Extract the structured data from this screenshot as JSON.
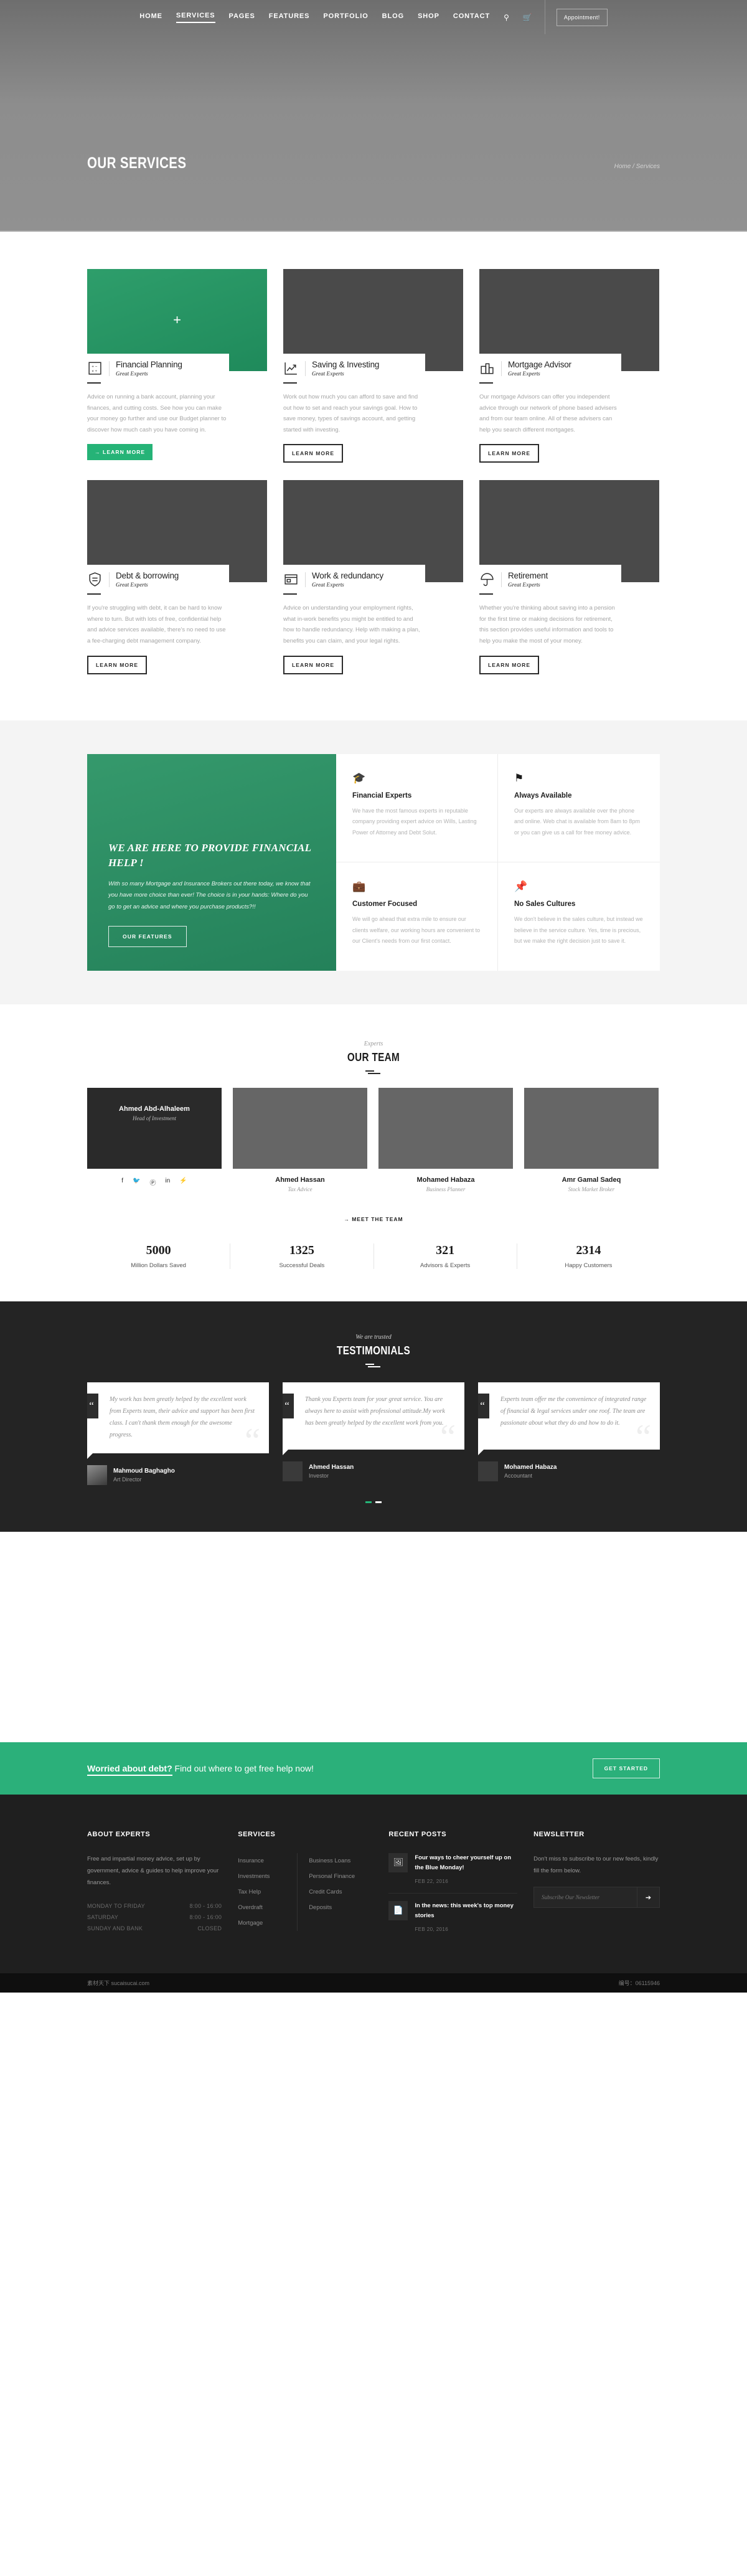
{
  "nav": {
    "items": [
      {
        "label": "HOME",
        "active": false
      },
      {
        "label": "SERVICES",
        "active": true
      },
      {
        "label": "PAGES",
        "active": false
      },
      {
        "label": "FEATURES",
        "active": false
      },
      {
        "label": "PORTFOLIO",
        "active": false
      },
      {
        "label": "BLOG",
        "active": false
      },
      {
        "label": "SHOP",
        "active": false
      },
      {
        "label": "CONTACT",
        "active": false
      }
    ],
    "search_icon": "⌕",
    "cart_icon": "Ὥ2",
    "appointment_label": "Appointment!"
  },
  "hero": {
    "title": "OUR SERVICES",
    "breadcrumb_home": "Home",
    "breadcrumb_sep": "/",
    "breadcrumb_current": "Services"
  },
  "services": {
    "cards": [
      {
        "title": "Financial Planning",
        "subtitle": "Great Experts",
        "desc": "Advice on running a bank account, planning your finances, and cutting costs. See how you can make your money go further and use our Budget planner to discover how much cash you have coming in.",
        "button": "→  LEARN MORE",
        "icon": "calculator-icon",
        "featured": true
      },
      {
        "title": "Saving & Investing",
        "subtitle": "Great Experts",
        "desc": "Work out how much you can afford to save and find out how to set and reach your savings goal. How to save money, types of savings account, and getting started with investing.",
        "button": "LEARN MORE",
        "icon": "chart-growth-icon",
        "featured": false
      },
      {
        "title": "Mortgage Advisor",
        "subtitle": "Great Experts",
        "desc": "Our mortgage Advisors can offer you independent advice through our network of phone based advisers and from our team online. All of these advisers can help you search different mortgages.",
        "button": "LEARN MORE",
        "icon": "buildings-icon",
        "featured": false
      },
      {
        "title": "Debt & borrowing",
        "subtitle": "Great Experts",
        "desc": "If you're struggling with debt, it can be hard to know where to turn. But with lots of free, confidential help and advice services available, there's no need to use a fee-charging debt management company.",
        "button": "LEARN MORE",
        "icon": "badge-document-icon",
        "featured": false
      },
      {
        "title": "Work & redundancy",
        "subtitle": "Great Experts",
        "desc": "Advice on understanding your employment rights, what in-work benefits you might be entitled to and how to handle redundancy. Help with making a plan, benefits you can claim, and your legal rights.",
        "button": "LEARN MORE",
        "icon": "credit-card-icon",
        "featured": false
      },
      {
        "title": "Retirement",
        "subtitle": "Great Experts",
        "desc": "Whether you're thinking about saving into a pension for the first time or making decisions for retirement, this section provides useful information and tools to help you make the most of your money.",
        "button": "LEARN MORE",
        "icon": "umbrella-icon",
        "featured": false
      }
    ]
  },
  "help": {
    "heading": "WE ARE HERE TO PROVIDE FINANCIAL HELP !",
    "paragraph": "With so many Mortgage and Insurance Brokers out there today, we know that you have more choice than ever! The choice is in your hands: Where do you go to get an advice and where you purchase products?!!",
    "button": "OUR FEATURES",
    "features": [
      {
        "icon": "graduation-cap-icon",
        "glyph": "🎓",
        "title": "Financial Experts",
        "desc": "We have the most famous experts in reputable company providing expert advice on Wills, Lasting Power of Attorney and Debt Solut."
      },
      {
        "icon": "flag-icon",
        "glyph": "⚑",
        "title": "Always Available",
        "desc": "Our experts are always available over the phone and online. Web chat is available from 8am to 8pm or you can give us a call for free money advice."
      },
      {
        "icon": "briefcase-icon",
        "glyph": "💼",
        "title": "Customer Focused",
        "desc": "We will go ahead that extra mile to ensure our clients welfare, our working hours are convenient to our Client's needs from our first contact."
      },
      {
        "icon": "pushpin-icon",
        "glyph": "📌",
        "title": "No Sales Cultures",
        "desc": "We don't believe in the sales culture, but instead we believe in the service culture. Yes, time is precious, but we make the right decision just to save it."
      }
    ]
  },
  "team": {
    "eyebrow": "Experts",
    "heading": "OUR TEAM",
    "members": [
      {
        "name": "Ahmed Abd-Alhaleem",
        "role": "Head of Investment",
        "featured": true
      },
      {
        "name": "Ahmed Hassan",
        "role": "Tax Advice",
        "featured": false
      },
      {
        "name": "Mohamed Habaza",
        "role": "Business Planner",
        "featured": false
      },
      {
        "name": "Amr Gamal Sadeq",
        "role": "Stock Market Broker",
        "featured": false
      }
    ],
    "socials": [
      {
        "name": "facebook-icon",
        "glyph": "f"
      },
      {
        "name": "twitter-icon",
        "glyph": "🐦"
      },
      {
        "name": "pinterest-icon",
        "glyph": "Ⓟ"
      },
      {
        "name": "linkedin-icon",
        "glyph": "in"
      },
      {
        "name": "rss-icon",
        "glyph": "⚡"
      }
    ],
    "meet_button": "→  MEET THE TEAM",
    "stats": [
      {
        "number": "5000",
        "label": "Million Dollars Saved"
      },
      {
        "number": "1325",
        "label": "Successful Deals"
      },
      {
        "number": "321",
        "label": "Advisors & Experts"
      },
      {
        "number": "2314",
        "label": "Happy Customers"
      }
    ]
  },
  "testimonials": {
    "eyebrow": "We are trusted",
    "heading": "TESTIMONIALS",
    "items": [
      {
        "quote": "My work has been greatly helped by the excellent work from Experts team, their advice and support has been first class. I can't thank them enough for the awesome progress.",
        "name": "Mahmoud Baghagho",
        "role": "Art Director",
        "has_photo": true
      },
      {
        "quote": "Thank you Experts team  for your great service. You are always here to assist with professional attitude.My work has been greatly helped by the excellent work from you.",
        "name": "Ahmed Hassan",
        "role": "Investor",
        "has_photo": false
      },
      {
        "quote": "Experts team offer me the convenience of integrated range of financial & legal services under one roof. The team are passionate about what they do and how to do it.",
        "name": "Mohamed Habaza",
        "role": "Accountant",
        "has_photo": false
      }
    ],
    "dots": [
      true,
      false
    ]
  },
  "cta": {
    "bold": "Worried about debt?",
    "rest": " Find out where to get free help now!",
    "button": "GET STARTED"
  },
  "footer": {
    "about": {
      "title": "ABOUT EXPERTS",
      "text": "Free and impartial money advice, set up by government, advice & guides to help improve your finances.",
      "hours": [
        {
          "day": "MONDAY TO FRIDAY",
          "time": "8:00 - 16:00"
        },
        {
          "day": "SATURDAY",
          "time": "8:00 - 16:00"
        },
        {
          "day": "SUNDAY AND BANK",
          "time": "CLOSED"
        }
      ]
    },
    "services": {
      "title": "SERVICES",
      "col1": [
        "Insurance",
        "Investments",
        "Tax Help",
        "Overdraft",
        "Mortgage"
      ],
      "col2": [
        "Business Loans",
        "Personal Finance",
        "Credit Cards",
        "Deposits"
      ]
    },
    "posts": {
      "title": "RECENT POSTS",
      "items": [
        {
          "title": "Four ways to cheer yourself up on the Blue Monday!",
          "date": "FEB 22, 2016",
          "icon": "image-icon",
          "glyph": "🖼"
        },
        {
          "title": "In the news: this week's top money stories",
          "date": "FEB 20, 2016",
          "icon": "document-icon",
          "glyph": "📄"
        }
      ]
    },
    "newsletter": {
      "title": "NEWSLETTER",
      "text": "Don't miss to subscribe to our new feeds, kindly fill the form below.",
      "placeholder": "Subscribe Our Newsletter",
      "submit_icon": "arrow-right-icon",
      "submit_glyph": "➔"
    }
  },
  "credit": {
    "left": "素材天下 sucaisucai.com",
    "right": "编号：06115946"
  }
}
